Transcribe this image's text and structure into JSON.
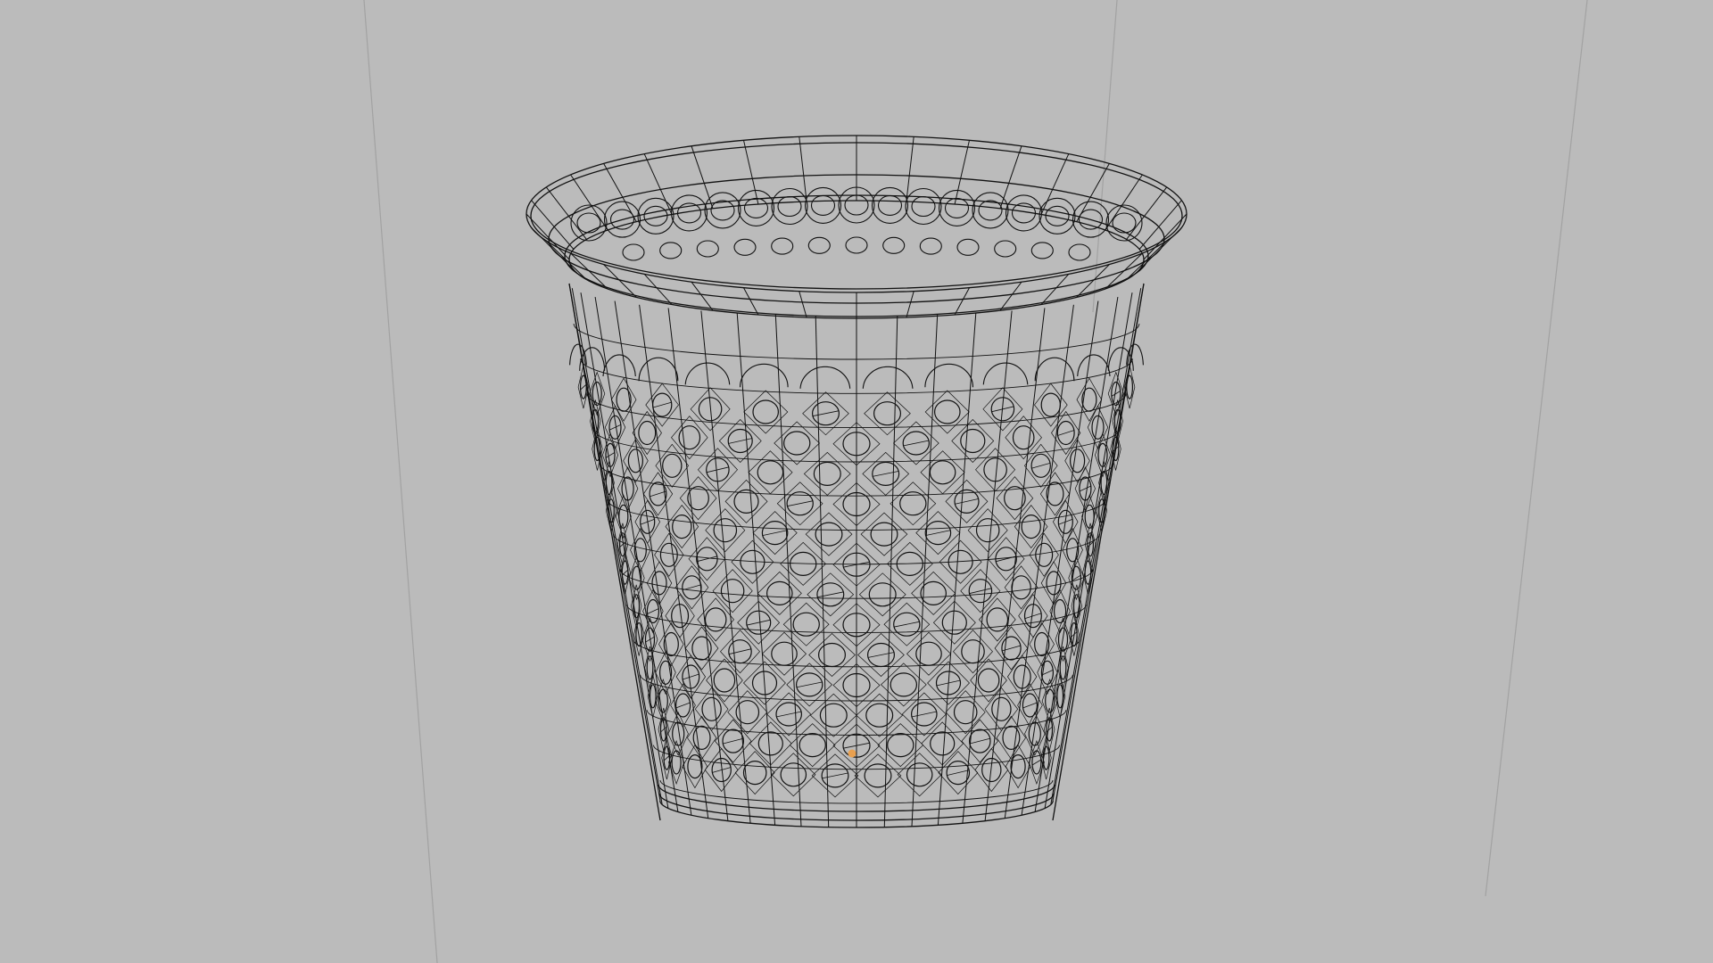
{
  "viewport": {
    "background_color": "#bbbbbb",
    "wire_color": "#111111",
    "guide_line_color": "#a2a2a2",
    "origin_marker_color": "#e8a050"
  },
  "model": {
    "icon": "wireframe-basket-mesh",
    "rows_of_holes": 13,
    "holes_per_row": 14
  }
}
